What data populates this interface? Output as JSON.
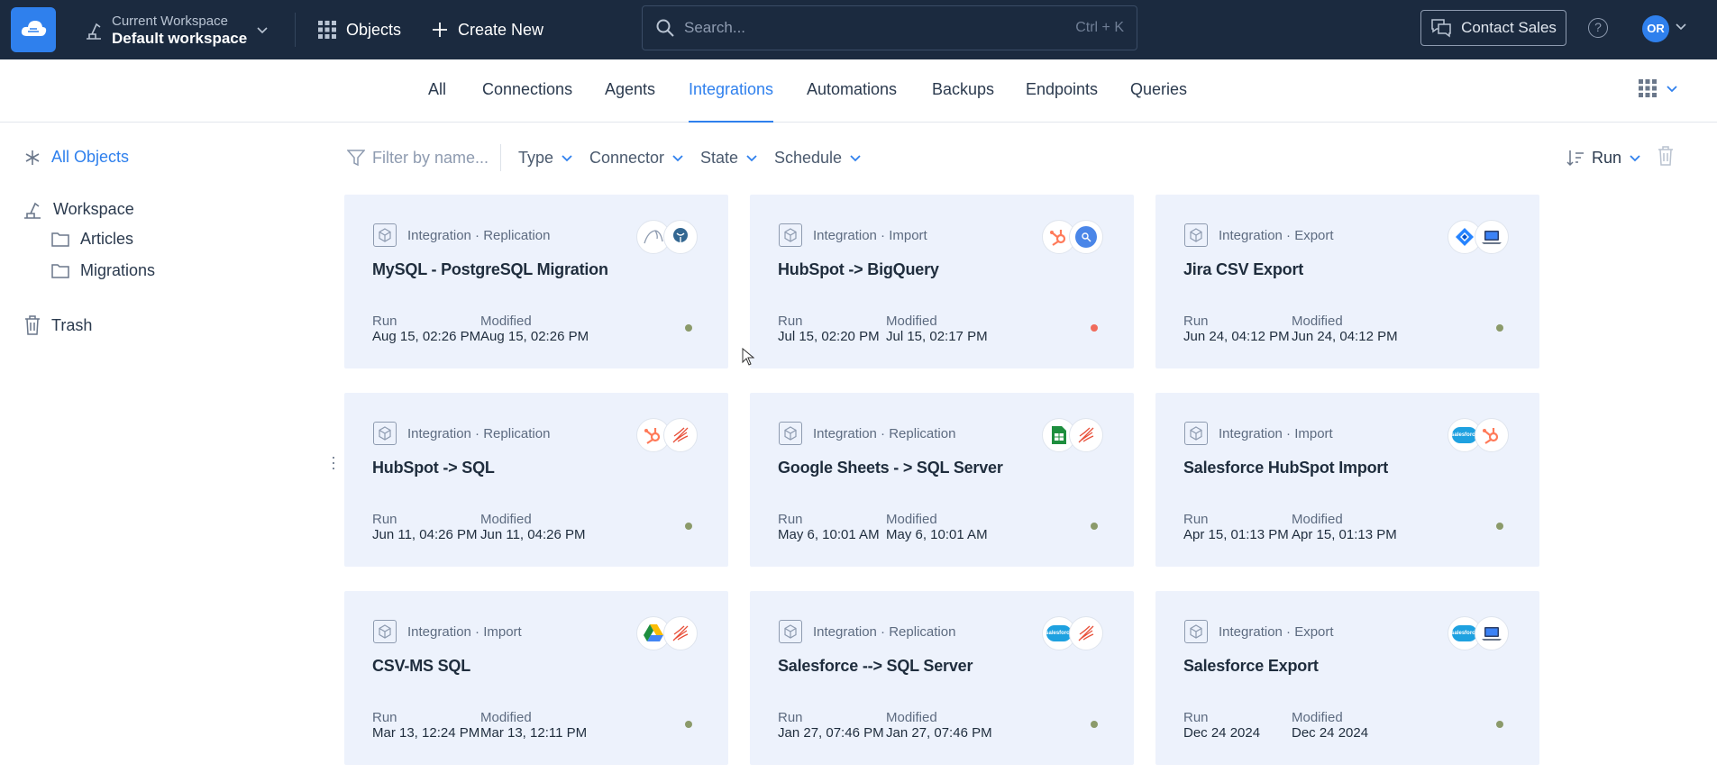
{
  "topbar": {
    "workspace_label": "Current Workspace",
    "workspace_name": "Default workspace",
    "objects_label": "Objects",
    "create_label": "Create New",
    "search_placeholder": "Search...",
    "search_shortcut": "Ctrl + K",
    "contact_label": "Contact Sales",
    "help_symbol": "?",
    "avatar_initials": "OR"
  },
  "tabs": [
    "All",
    "Connections",
    "Agents",
    "Integrations",
    "Automations",
    "Backups",
    "Endpoints",
    "Queries"
  ],
  "active_tab": "Integrations",
  "sidebar": {
    "all_objects": "All Objects",
    "workspace": "Workspace",
    "folders": [
      "Articles",
      "Migrations"
    ],
    "trash": "Trash"
  },
  "filters": {
    "name_placeholder": "Filter by name...",
    "type": "Type",
    "connector": "Connector",
    "state": "State",
    "schedule": "Schedule",
    "sort_label": "Run"
  },
  "cards": [
    {
      "kind": "Integration · Replication",
      "title": "MySQL - PostgreSQL Migration",
      "run_label": "Run",
      "run": "Aug 15, 02:26 PM",
      "modified_label": "Modified",
      "modified": "Aug 15, 02:26 PM",
      "status_color": "#8b9a6a",
      "icons": [
        "mysql-icon",
        "postgresql-icon"
      ]
    },
    {
      "kind": "Integration · Import",
      "title": "HubSpot -> BigQuery",
      "run_label": "Run",
      "run": "Jul 15, 02:20 PM",
      "modified_label": "Modified",
      "modified": "Jul 15, 02:17 PM",
      "status_color": "#f06b5b",
      "icons": [
        "hubspot-icon",
        "bigquery-icon"
      ]
    },
    {
      "kind": "Integration · Export",
      "title": "Jira CSV Export",
      "run_label": "Run",
      "run": "Jun 24, 04:12 PM",
      "modified_label": "Modified",
      "modified": "Jun 24, 04:12 PM",
      "status_color": "#8b9a6a",
      "icons": [
        "jira-icon",
        "laptop-icon"
      ]
    },
    {
      "kind": "Integration · Replication",
      "title": "HubSpot -> SQL",
      "run_label": "Run",
      "run": "Jun 11, 04:26 PM",
      "modified_label": "Modified",
      "modified": "Jun 11, 04:26 PM",
      "status_color": "#8b9a6a",
      "icons": [
        "hubspot-icon",
        "sql-server-icon"
      ]
    },
    {
      "kind": "Integration · Replication",
      "title": "Google Sheets - > SQL Server",
      "run_label": "Run",
      "run": "May 6, 10:01 AM",
      "modified_label": "Modified",
      "modified": "May 6, 10:01 AM",
      "status_color": "#8b9a6a",
      "icons": [
        "google-sheets-icon",
        "sql-server-icon"
      ]
    },
    {
      "kind": "Integration · Import",
      "title": "Salesforce HubSpot Import",
      "run_label": "Run",
      "run": "Apr 15, 01:13 PM",
      "modified_label": "Modified",
      "modified": "Apr 15, 01:13 PM",
      "status_color": "#8b9a6a",
      "icons": [
        "salesforce-icon",
        "hubspot-icon"
      ]
    },
    {
      "kind": "Integration · Import",
      "title": "CSV-MS SQL",
      "run_label": "Run",
      "run": "Mar 13, 12:24 PM",
      "modified_label": "Modified",
      "modified": "Mar 13, 12:11 PM",
      "status_color": "#8b9a6a",
      "icons": [
        "google-drive-icon",
        "sql-server-icon"
      ]
    },
    {
      "kind": "Integration · Replication",
      "title": "Salesforce --> SQL Server",
      "run_label": "Run",
      "run": "Jan 27, 07:46 PM",
      "modified_label": "Modified",
      "modified": "Jan 27, 07:46 PM",
      "status_color": "#8b9a6a",
      "icons": [
        "salesforce-icon",
        "sql-server-icon"
      ]
    },
    {
      "kind": "Integration · Export",
      "title": "Salesforce Export",
      "run_label": "Run",
      "run": "Dec 24 2024",
      "modified_label": "Modified",
      "modified": "Dec 24 2024",
      "status_color": "#8b9a6a",
      "icons": [
        "salesforce-icon",
        "laptop-icon"
      ]
    }
  ],
  "colors": {
    "accent": "#2f80ed",
    "topbar": "#1b2a3f",
    "card_bg": "#edf2fc"
  }
}
